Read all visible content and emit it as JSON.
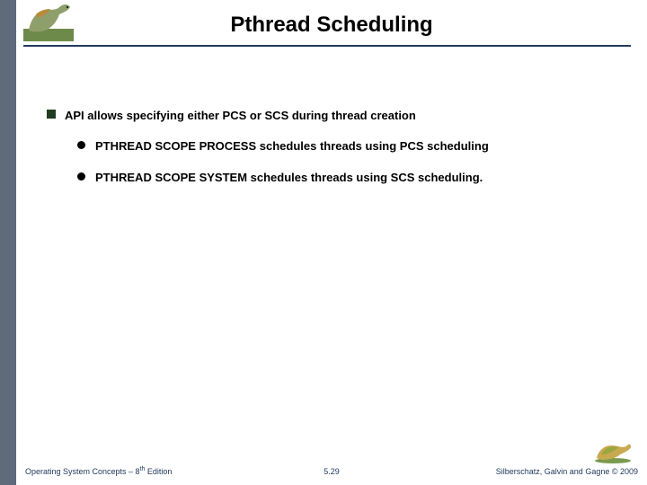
{
  "header": {
    "title": "Pthread Scheduling"
  },
  "bullets": {
    "main": "API allows specifying either PCS or SCS during thread creation",
    "sub1": "PTHREAD SCOPE PROCESS schedules threads using PCS scheduling",
    "sub2": "PTHREAD SCOPE SYSTEM schedules threads using SCS scheduling."
  },
  "footer": {
    "left_pre": "Operating System Concepts – 8",
    "left_sup": "th",
    "left_post": " Edition",
    "center": "5.29",
    "right": "Silberschatz, Galvin and Gagne © 2009"
  }
}
